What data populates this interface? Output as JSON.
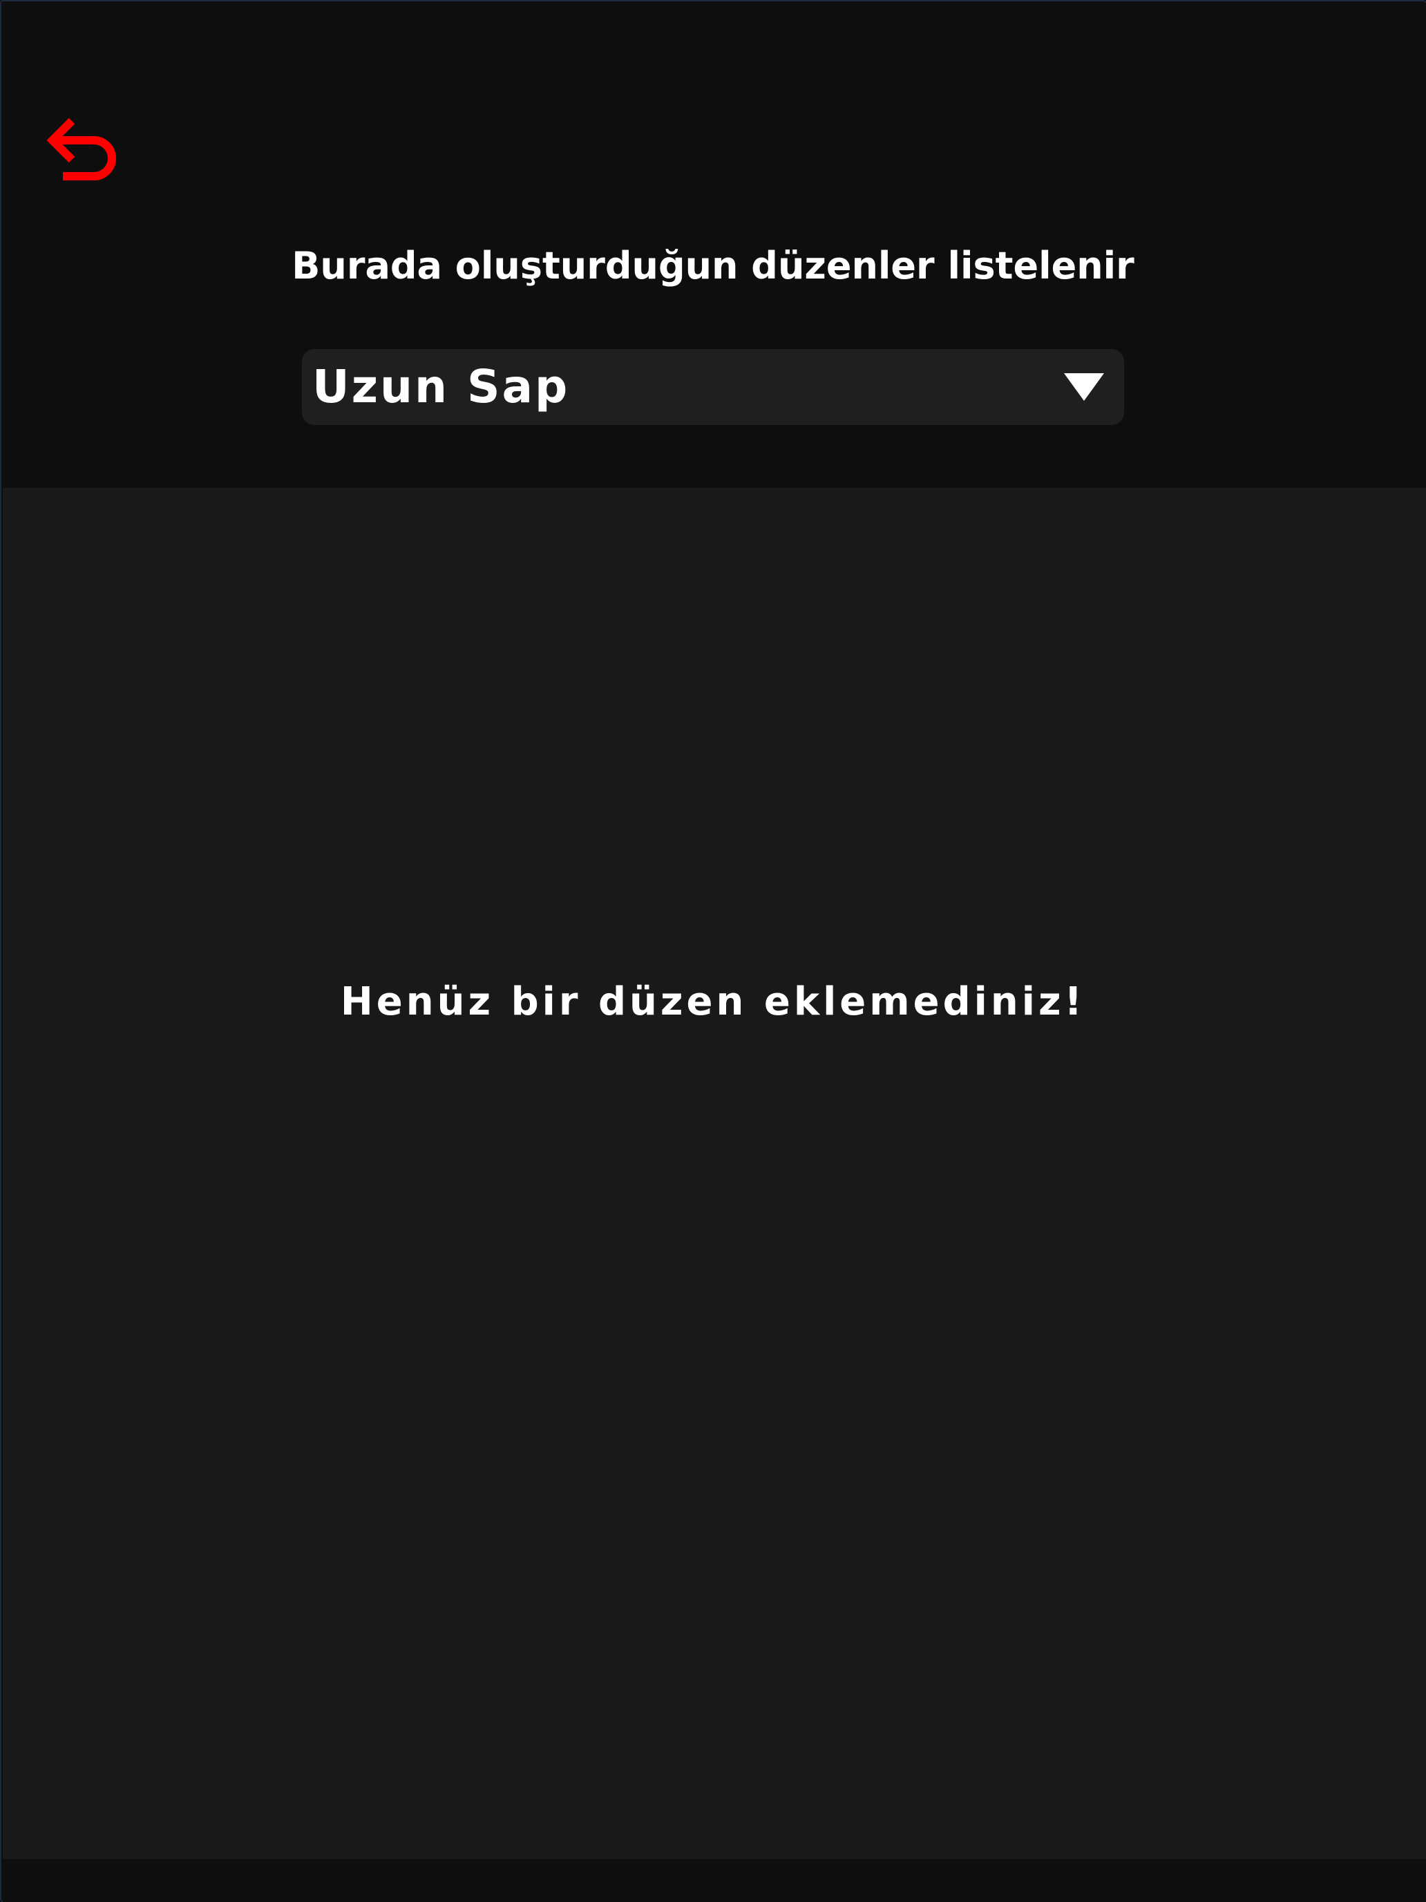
{
  "header": {
    "back_icon": "undo-arrow-icon",
    "title": "Burada oluşturduğun düzenler listelenir"
  },
  "selector": {
    "value": "Uzun Sap",
    "arrow_icon": "triangle-down-icon"
  },
  "content": {
    "empty_message": "Henüz bir düzen eklemediniz!"
  },
  "colors": {
    "accent": "#ff0000",
    "background": "#0e0e0f",
    "panel": "#191919",
    "selector_bg": "#1f1f20",
    "text": "#ffffff"
  }
}
